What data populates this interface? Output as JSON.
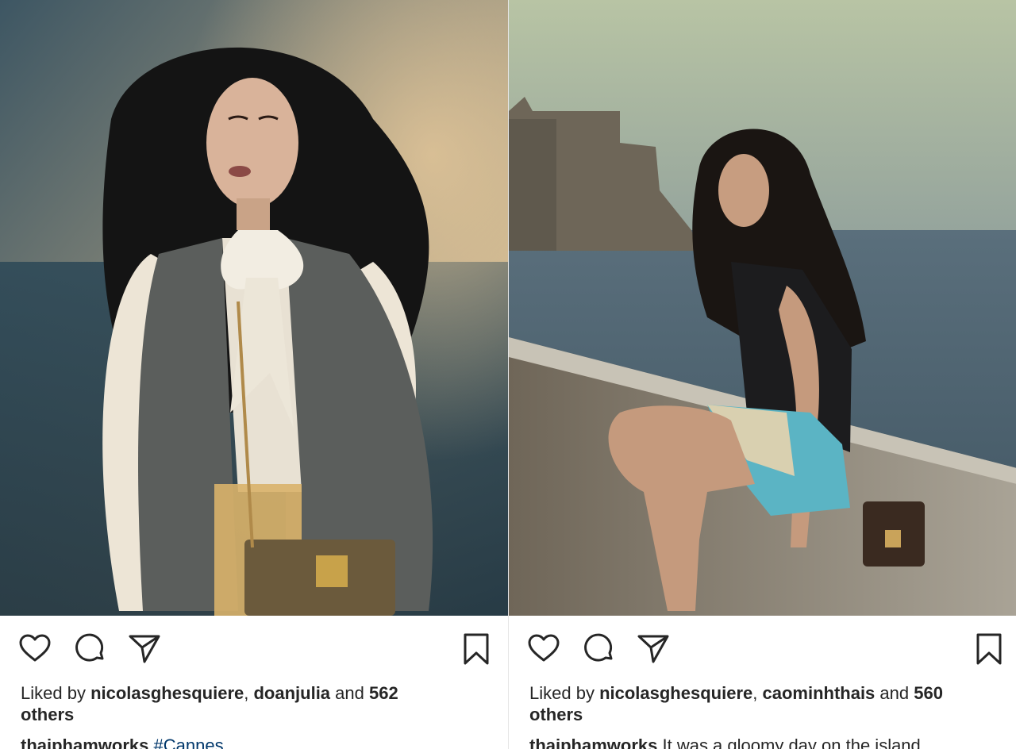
{
  "posts": [
    {
      "image_alt": "Woman with long dark hair wearing a white ruffled blouse and embroidered vest, holding a studded trunk bag, by the sea at dusk",
      "actions": {
        "like": "heart-icon",
        "comment": "comment-icon",
        "share": "send-icon",
        "save": "bookmark-icon"
      },
      "likes": {
        "prefix": "Liked by ",
        "user1": "nicolasghesquiere",
        "sep": ", ",
        "user2": "doanjulia",
        "and": " and ",
        "count": "562",
        "suffix": "others"
      },
      "caption": {
        "username": "thaiphamworks",
        "text": "",
        "hashtag": "#Cannes"
      }
    },
    {
      "image_alt": "Woman in black top and floral shorts sitting on a stone seawall with a small trunk bag, castle in the background",
      "actions": {
        "like": "heart-icon",
        "comment": "comment-icon",
        "share": "send-icon",
        "save": "bookmark-icon"
      },
      "likes": {
        "prefix": "Liked by ",
        "user1": "nicolasghesquiere",
        "sep": ", ",
        "user2": "caominhthais",
        "and": " and ",
        "count": "560",
        "suffix": "others"
      },
      "caption": {
        "username": "thaiphamworks",
        "text": " It was a gloomy day on the island",
        "hashtag": ""
      }
    }
  ],
  "colors": {
    "text": "#262626",
    "hashtag": "#00376b",
    "background": "#ffffff"
  }
}
